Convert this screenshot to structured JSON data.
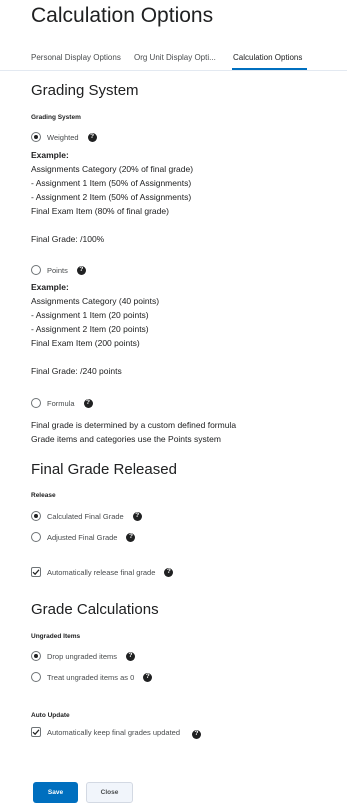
{
  "page": {
    "title": "Calculation Options"
  },
  "tabs": [
    {
      "label": "Personal Display Options",
      "active": false
    },
    {
      "label": "Org Unit Display Opti...",
      "active": false
    },
    {
      "label": "Calculation Options",
      "active": true
    }
  ],
  "grading_system": {
    "heading": "Grading System",
    "label": "Grading System",
    "options": [
      {
        "label": "Weighted",
        "selected": true,
        "example_title": "Example:",
        "example_lines": [
          "Assignments Category (20% of final grade)",
          "- Assignment 1 Item (50% of Assignments)",
          "- Assignment 2 Item (50% of Assignments)",
          "Final Exam Item (80% of final grade)"
        ],
        "final_grade": "Final Grade: /100%"
      },
      {
        "label": "Points",
        "selected": false,
        "example_title": "Example:",
        "example_lines": [
          "Assignments Category (40 points)",
          "- Assignment 1 Item (20 points)",
          "- Assignment 2 Item (20 points)",
          "Final Exam Item (200 points)"
        ],
        "final_grade": "Final Grade: /240 points"
      },
      {
        "label": "Formula",
        "selected": false,
        "description_lines": [
          "Final grade is determined by a custom defined formula",
          "Grade items and categories use the Points system"
        ]
      }
    ]
  },
  "final_grade_released": {
    "heading": "Final Grade Released",
    "label": "Release",
    "options": [
      {
        "label": "Calculated Final Grade",
        "selected": true
      },
      {
        "label": "Adjusted Final Grade",
        "selected": false
      }
    ],
    "auto_release": {
      "label": "Automatically release final grade",
      "checked": true
    }
  },
  "grade_calculations": {
    "heading": "Grade Calculations",
    "ungraded_label": "Ungraded Items",
    "options": [
      {
        "label": "Drop ungraded items",
        "selected": true
      },
      {
        "label": "Treat ungraded items as 0",
        "selected": false
      }
    ],
    "auto_update_label": "Auto Update",
    "auto_update": {
      "label": "Automatically keep final grades updated",
      "checked": true
    }
  },
  "buttons": {
    "save": "Save",
    "close": "Close"
  },
  "icons": {
    "help": "question-circle-icon",
    "check": "checkmark-icon"
  },
  "colors": {
    "primary": "#006fbf",
    "text": "#202122",
    "secondary_button_bg": "#f1f5fb"
  }
}
